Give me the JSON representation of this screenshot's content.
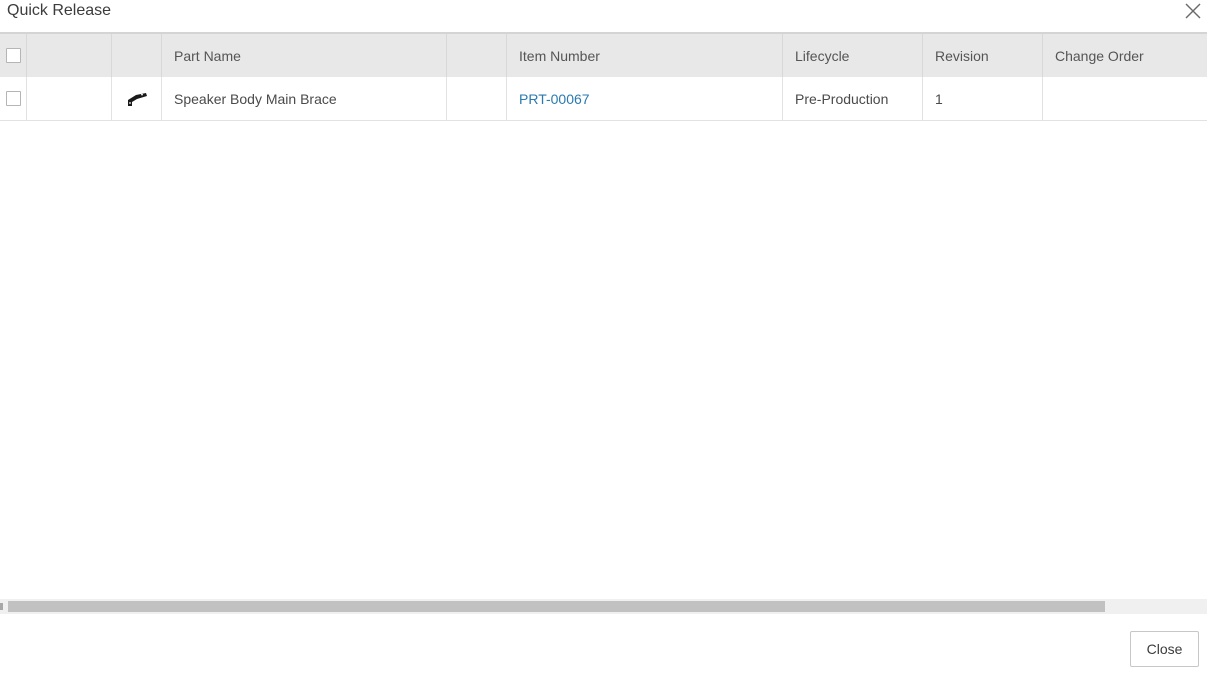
{
  "dialog": {
    "title": "Quick Release",
    "close_button_label": "Close"
  },
  "table": {
    "columns": [
      "",
      "",
      "",
      "Part Name",
      "",
      "Item Number",
      "Lifecycle",
      "Revision",
      "Change Order"
    ],
    "rows": [
      {
        "icon": "bracket-part-icon",
        "part_name": "Speaker Body Main Brace",
        "item_number": "PRT-00067",
        "lifecycle": "Pre-Production",
        "revision": "1",
        "change_order": ""
      }
    ]
  },
  "colors": {
    "header_bg": "#e8e8e8",
    "link": "#2a7ab0",
    "scrollbar_thumb": "#c1c1c1"
  }
}
